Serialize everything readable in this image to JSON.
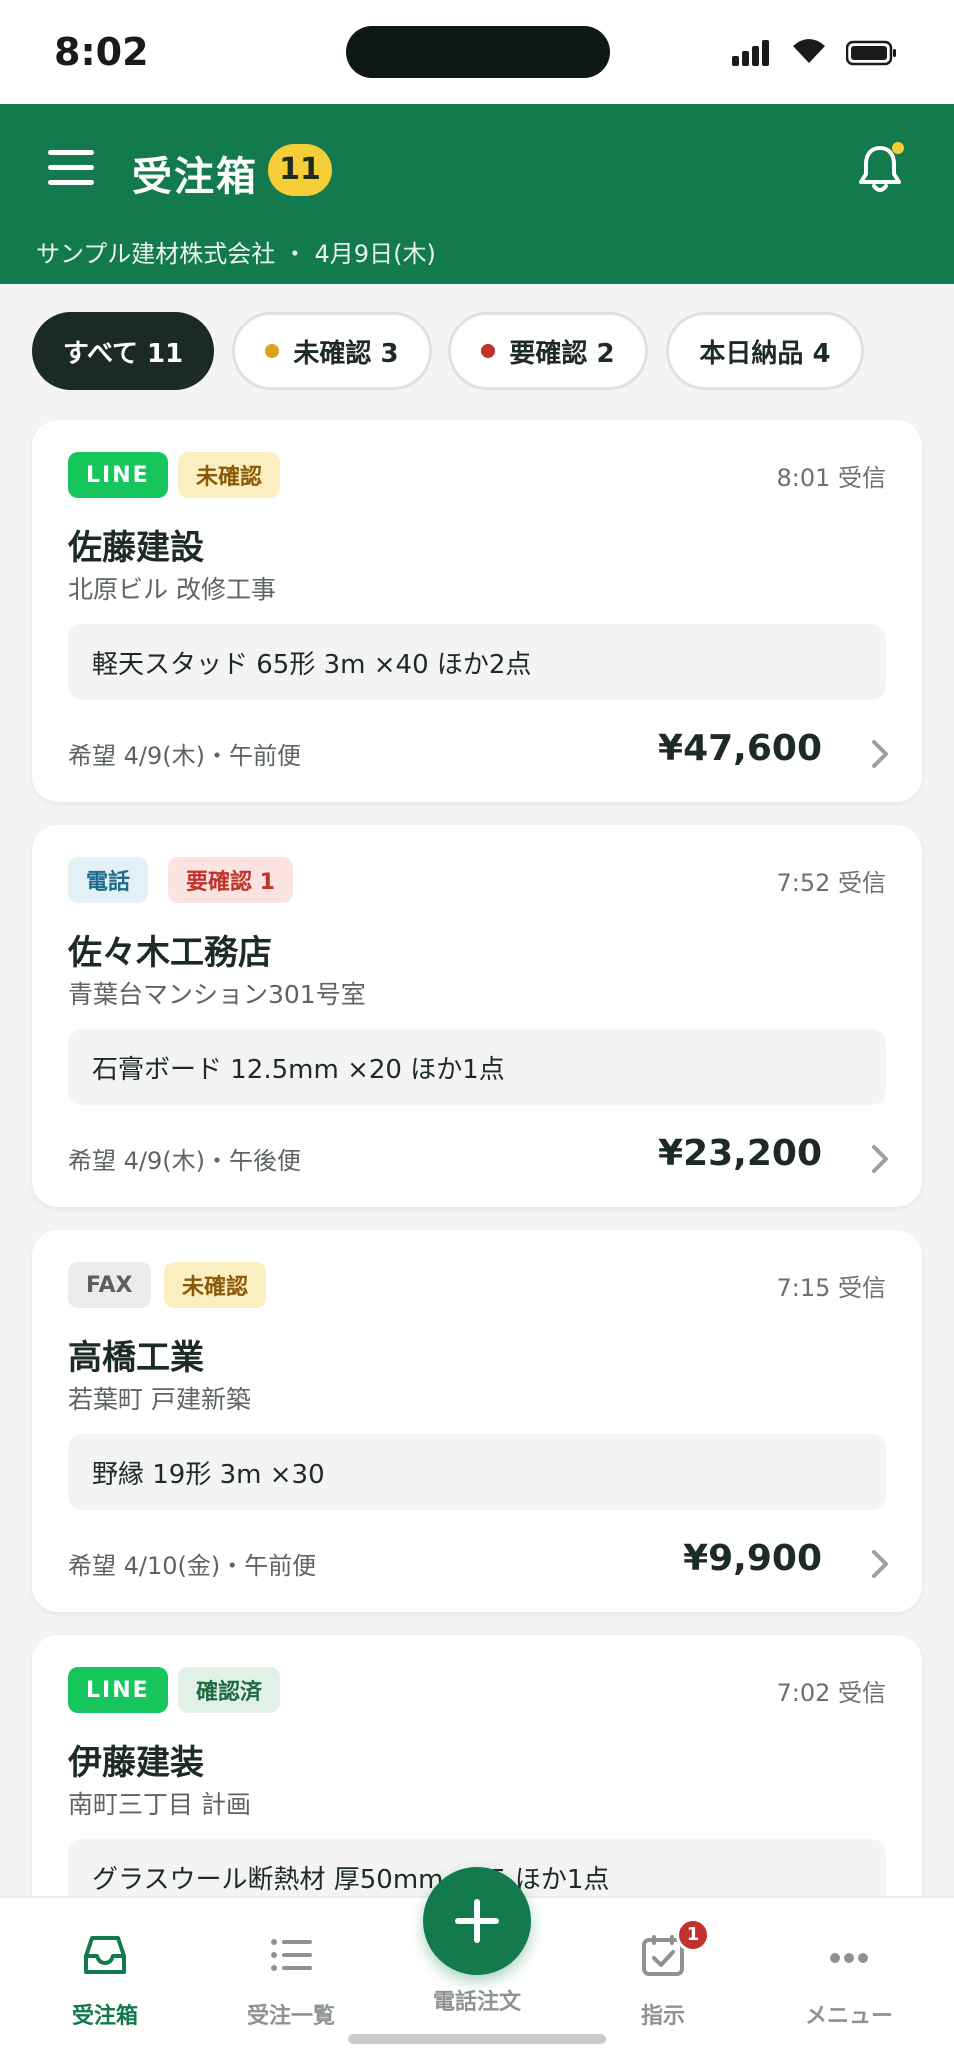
{
  "status_bar": {
    "time": "8:02"
  },
  "header": {
    "title": "受注箱",
    "count": "11",
    "subtitle": "サンプル建材株式会社 ・ 4月9日(木)"
  },
  "filters": [
    {
      "label": "すべて 11",
      "active": true
    },
    {
      "label": "未確認 3",
      "dot_color": "#d9a21b"
    },
    {
      "label": "要確認 2",
      "dot_color": "#c0332b"
    },
    {
      "label": "本日納品 4"
    }
  ],
  "orders": [
    {
      "channel": "LINE",
      "status": "未確認",
      "received": "8:01 受信",
      "customer": "佐藤建設",
      "project": "北原ビル 改修工事",
      "items": "軽天スタッド 65形 3m ×40 ほか2点",
      "delivery": "希望 4/9(木)・午前便",
      "price": "¥47,600"
    },
    {
      "channel": "電話",
      "status": "要確認 1",
      "received": "7:52 受信",
      "customer": "佐々木工務店",
      "project": "青葉台マンション301号室",
      "items": "石膏ボード 12.5mm ×20 ほか1点",
      "delivery": "希望 4/9(木)・午後便",
      "price": "¥23,200"
    },
    {
      "channel": "FAX",
      "status": "未確認",
      "received": "7:15 受信",
      "customer": "高橋工業",
      "project": "若葉町 戸建新築",
      "items": "野縁 19形 3m ×30",
      "delivery": "希望 4/10(金)・午前便",
      "price": "¥9,900"
    },
    {
      "channel": "LINE",
      "status": "確認済",
      "received": "7:02 受信",
      "customer": "伊藤建装",
      "project": "南町三丁目 計画",
      "items": "グラスウール断熱材 厚50mm ×15 ほか1点",
      "delivery": "",
      "price": ""
    }
  ],
  "bottom_nav": {
    "inbox": "受注箱",
    "list": "受注一覧",
    "phone_order": "電話注文",
    "instructions": "指示",
    "instructions_badge": "1",
    "menu": "メニュー"
  },
  "colors": {
    "brand": "#137a4e",
    "accent_yellow": "#f5cd36",
    "line_green": "#16c55c",
    "alert_red": "#c0332b"
  },
  "icons": [
    "hamburger-icon",
    "bell-icon",
    "chevron-right-icon",
    "inbox-icon",
    "list-icon",
    "plus-icon",
    "calendar-check-icon",
    "more-icon"
  ]
}
